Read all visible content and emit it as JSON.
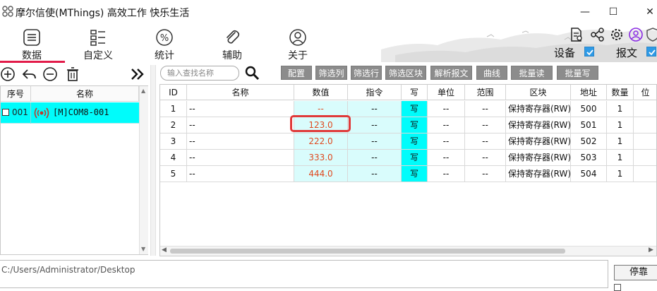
{
  "window": {
    "title": "摩尔信使(MThings) 高效工作 快乐生活",
    "minimize": "—",
    "maximize": "☐",
    "close": "✕"
  },
  "nav": [
    {
      "label": "数据",
      "icon": "list-icon"
    },
    {
      "label": "自定义",
      "icon": "grid-list-icon"
    },
    {
      "label": "统计",
      "icon": "percent-icon"
    },
    {
      "label": "辅助",
      "icon": "paperclip-icon"
    },
    {
      "label": "关于",
      "icon": "user-icon"
    }
  ],
  "top_right": {
    "device_label": "设备",
    "device_checked": true,
    "message_label": "报文",
    "message_checked": true
  },
  "left_panel": {
    "headers": {
      "index": "序号",
      "name": "名称"
    },
    "rows": [
      {
        "index": "001",
        "name": "[M]COM8-001",
        "checked": false
      }
    ]
  },
  "search": {
    "placeholder": "输入查找名称"
  },
  "toolbar": [
    "配置",
    "筛选列",
    "筛选行",
    "筛选区块",
    "解析报文",
    "曲线",
    "批量读",
    "批量写"
  ],
  "grid": {
    "headers": [
      "ID",
      "名称",
      "数值",
      "指令",
      "写",
      "单位",
      "范围",
      "区块",
      "地址",
      "数量",
      "位"
    ],
    "rows": [
      {
        "id": "1",
        "name": "--",
        "value": "--",
        "command": "--",
        "write": "写",
        "unit": "--",
        "range": "--",
        "block": "保持寄存器(RW)",
        "address": "500",
        "count": "1"
      },
      {
        "id": "2",
        "name": "--",
        "value": "123.0",
        "command": "--",
        "write": "写",
        "unit": "--",
        "range": "--",
        "block": "保持寄存器(RW)",
        "address": "501",
        "count": "1"
      },
      {
        "id": "3",
        "name": "--",
        "value": "222.0",
        "command": "--",
        "write": "写",
        "unit": "--",
        "range": "--",
        "block": "保持寄存器(RW)",
        "address": "502",
        "count": "1"
      },
      {
        "id": "4",
        "name": "--",
        "value": "333.0",
        "command": "--",
        "write": "写",
        "unit": "--",
        "range": "--",
        "block": "保持寄存器(RW)",
        "address": "503",
        "count": "1"
      },
      {
        "id": "5",
        "name": "--",
        "value": "444.0",
        "command": "--",
        "write": "写",
        "unit": "--",
        "range": "--",
        "block": "保持寄存器(RW)",
        "address": "504",
        "count": "1"
      }
    ]
  },
  "bottom": {
    "path": "C:/Users/Administrator/Desktop",
    "stop_label": "停靠"
  },
  "colors": {
    "accent_underline": "#e21b49",
    "row_selected": "#00fcfb",
    "value_text": "#e0491f",
    "highlight_box": "#e03a3a",
    "checkbox": "#2e9ae6"
  }
}
